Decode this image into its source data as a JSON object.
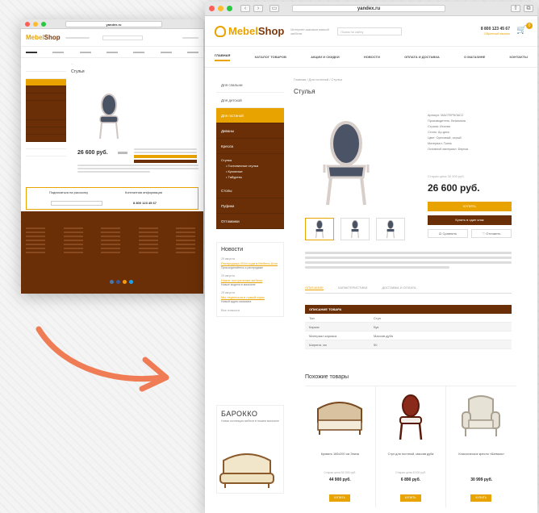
{
  "big": {
    "url": "yandex.ru",
    "logo_text": "Mebel",
    "logo_text2": "Shop",
    "tagline": "Интернет-магазин мягкой мебели",
    "search_placeholder": "Поиск по сайту",
    "phone": "8 800 123 45 67",
    "phone_sub": "Обратный звонок",
    "cart_count": "0",
    "menu": [
      "Главная",
      "Каталог товаров",
      "Акции и скидки",
      "Новости",
      "Оплата и доставка",
      "О магазине",
      "Контакты"
    ],
    "sidebar": [
      "Для спальни",
      "Для детской",
      "Для гостиной",
      "Диваны",
      "Кресла",
      "Стулья",
      "Столы",
      "Пуфики",
      "Оттоманки"
    ],
    "sidebar_sub": [
      "Гостиничные стулья",
      "Кухонные",
      "Табуреты"
    ],
    "news_title": "Новости",
    "news": [
      {
        "date": "29 августа",
        "title": "Распродажа 2016 года в Мебель-Шоп",
        "text": "Присоединяйтесь к распродаже"
      },
      {
        "date": "29 августа",
        "title": "Новое поступление мебели",
        "text": "Новые модели в магазине"
      },
      {
        "date": "29 августа",
        "title": "Мы переехали в новый офис",
        "text": "Новый адрес магазина"
      }
    ],
    "news_all": "Все новости",
    "promo_title": "БАРОККО",
    "promo_text": "Новая коллекция мебели в нашем магазине",
    "breadcrumb": "Главная / Для гостиной / Стулья",
    "page_title": "Стулья",
    "specs": [
      "Артикул: МАСТЕРКЛАСС",
      "Производитель: Belarussia",
      "Страна: Италия",
      "Стиль: Ар-деко",
      "Цвет: Ореховый, серый",
      "Материал: Ткань",
      "Основной материал: Береза"
    ],
    "old_price": "Старая цена 30 000 руб.",
    "price": "26 600 руб.",
    "buy_label": "Купить",
    "oneclick_label": "Купить в один клик",
    "compare_label": "Сравнить",
    "defer_label": "Отложить",
    "tabs": [
      "Описание",
      "Характеристики",
      "Доставка и оплата"
    ],
    "table_header": "Описание товара",
    "table_rows": [
      [
        "Тип",
        "Стул"
      ],
      [
        "Каркас",
        "Бук"
      ],
      [
        "Материал каркаса",
        "Массив дуба"
      ],
      [
        "Ширина, см",
        "50"
      ]
    ],
    "similar_title": "Похожие товары",
    "products": [
      {
        "name": "Кровать 160х200 см Элиза",
        "old": "Старая цена 52 000 руб.",
        "price": "44 900 руб.",
        "btn": "Купить"
      },
      {
        "name": "Стул для гостиной, массив дуба",
        "old": "Старая цена 8 000 руб.",
        "price": "6 890 руб.",
        "btn": "Купить"
      },
      {
        "name": "Классическое кресло «Шеваль»",
        "old": "",
        "price": "30 999 руб.",
        "btn": "Купить"
      }
    ]
  },
  "small": {
    "url": "yandex.ru",
    "logo_text": "Mebel",
    "logo_text2": "Shop",
    "price": "26 600 руб.",
    "page_title": "Стулья",
    "sub_title": "Подписаться на рассылку",
    "contact_title": "Контактная информация",
    "phone": "8 800 123 45 67"
  },
  "colors": {
    "accent": "#e8a300",
    "brown": "#6a2f06",
    "arrow": "#f07c55"
  }
}
